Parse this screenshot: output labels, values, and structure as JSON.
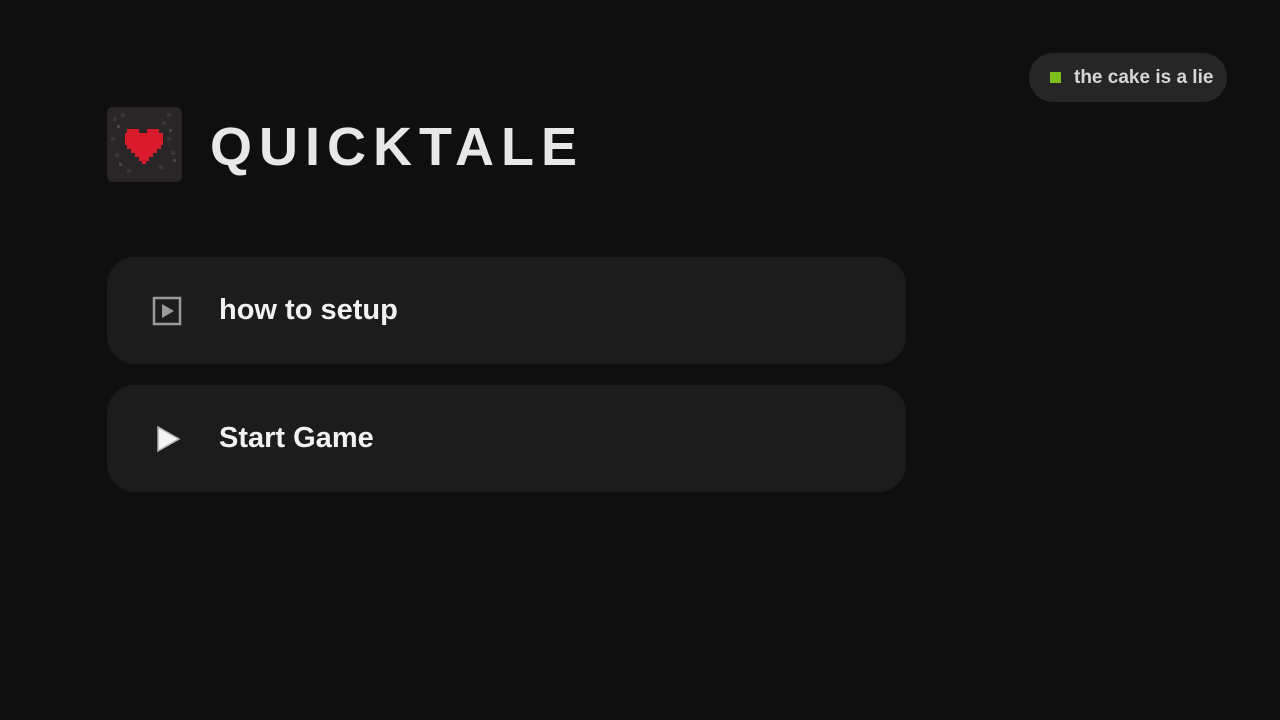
{
  "status": {
    "text": "the cake is a lie",
    "dot_color": "#7fbd1c",
    "icon": "status-square-icon"
  },
  "header": {
    "title": "QUICKTALE",
    "logo_icon": "pixel-heart-logo"
  },
  "menu": {
    "items": [
      {
        "label": "how to setup",
        "icon": "video-play-icon"
      },
      {
        "label": "Start Game",
        "icon": "play-triangle-icon"
      }
    ]
  },
  "colors": {
    "background": "#0f0f0f",
    "button": "#1c1c1c",
    "pill": "#262626",
    "heart": "#d81b2a",
    "text": "#f2f2f2"
  }
}
